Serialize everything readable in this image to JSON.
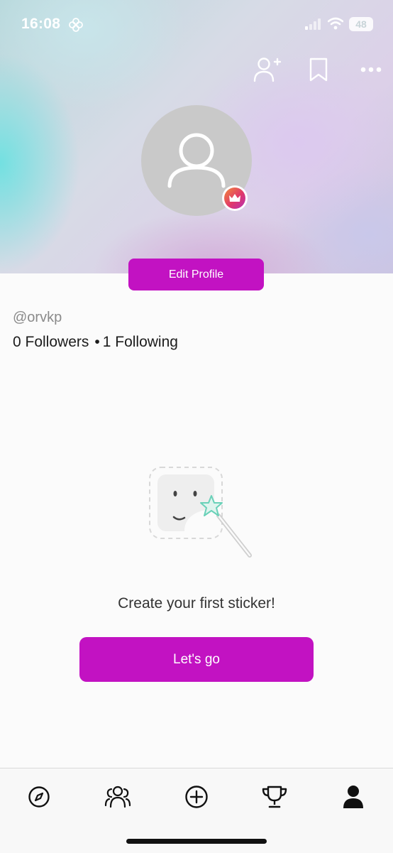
{
  "status_bar": {
    "time": "16:08",
    "battery": "48",
    "icons": [
      "flower-icon",
      "signal-icon",
      "wifi-icon",
      "battery-icon"
    ]
  },
  "header_actions": {
    "icons": [
      "add-friend-icon",
      "bookmark-icon",
      "more-icon"
    ]
  },
  "profile": {
    "avatar_icon": "user-icon",
    "badge_icon": "crown-icon",
    "edit_button_label": "Edit Profile",
    "username": "@orvkp",
    "followers": "0 Followers",
    "separator": "•",
    "following": "1 Following"
  },
  "empty_state": {
    "illustration_icon": "sticker-magic-wand-icon",
    "message": "Create your first sticker!",
    "button_label": "Let's go"
  },
  "tab_bar": {
    "tabs": [
      {
        "name": "explore",
        "icon": "compass-icon",
        "active": false
      },
      {
        "name": "friends",
        "icon": "people-icon",
        "active": false
      },
      {
        "name": "create",
        "icon": "plus-circle-icon",
        "active": false
      },
      {
        "name": "leaderboard",
        "icon": "trophy-icon",
        "active": false
      },
      {
        "name": "profile",
        "icon": "person-icon",
        "active": true
      }
    ]
  },
  "colors": {
    "accent": "#c212c2",
    "background": "#fbfbfb",
    "avatar_placeholder": "#c9c9c9",
    "muted_text": "#8a8a8a"
  }
}
